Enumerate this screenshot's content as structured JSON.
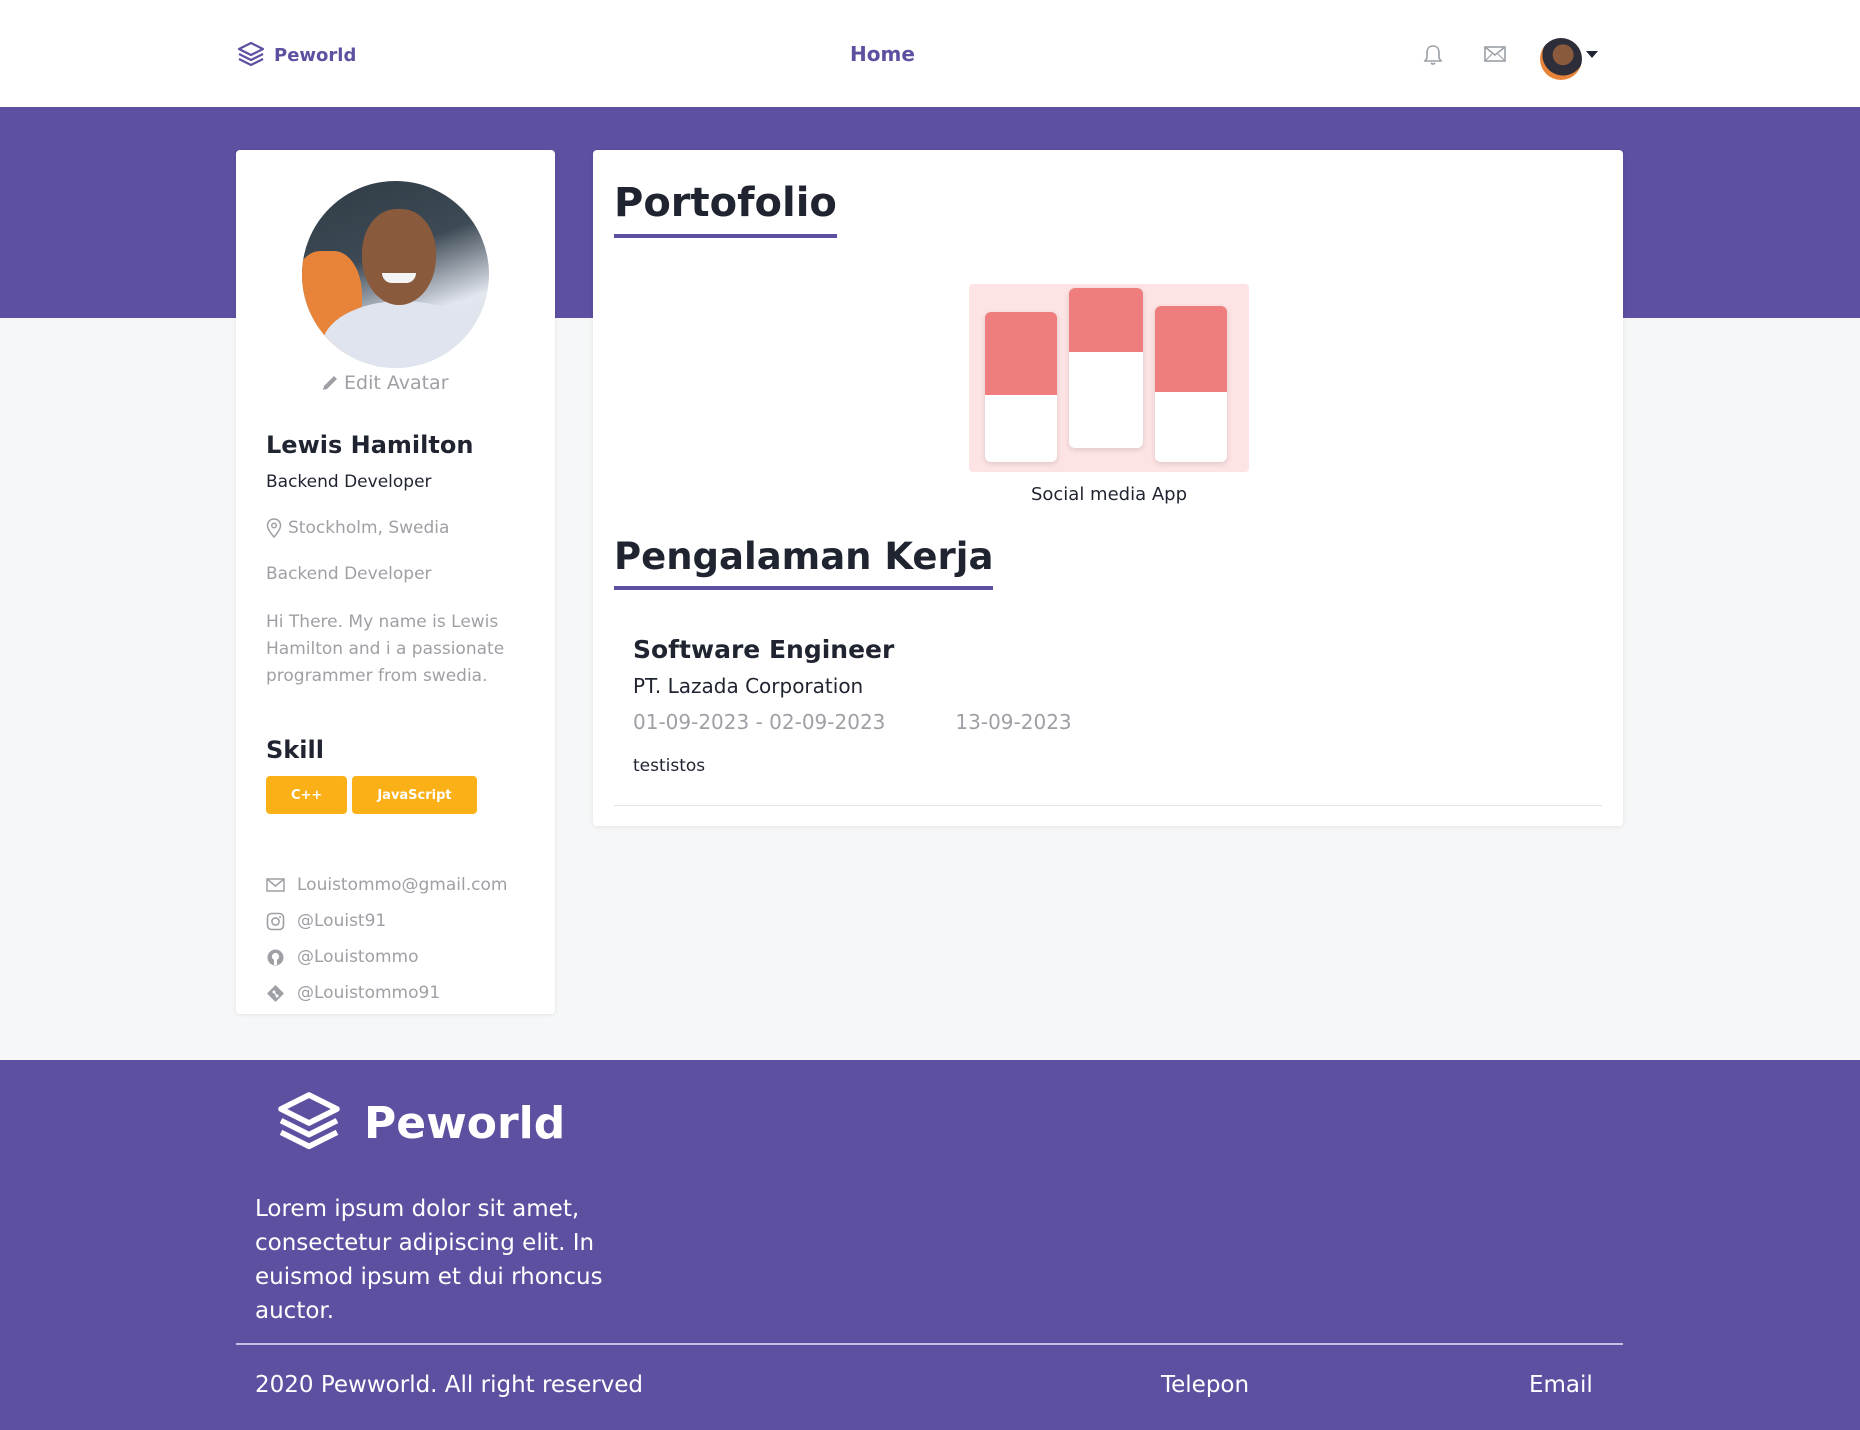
{
  "nav": {
    "brand": "Peworld",
    "home": "Home",
    "icons": [
      "layers-icon",
      "bell-icon",
      "mail-icon",
      "avatar",
      "chevron-down-icon"
    ]
  },
  "profile": {
    "edit_avatar": "Edit Avatar",
    "name": "Lewis Hamilton",
    "job": "Backend Developer",
    "location": "Stockholm, Swedia",
    "job_detail": "Backend Developer",
    "bio": "Hi There. My name is Lewis Hamilton and i a passionate programmer from swedia.",
    "skill_title": "Skill",
    "skills": [
      "C++",
      "JavaScript"
    ],
    "contacts": {
      "email": "Louistommo@gmail.com",
      "instagram": "@Louist91",
      "github": "@Louistommo",
      "gitlab": "@Louistommo91"
    }
  },
  "portfolio": {
    "title": "Portofolio",
    "items": [
      {
        "caption": "Social media App"
      }
    ]
  },
  "experience": {
    "title": "Pengalaman Kerja",
    "items": [
      {
        "role": "Software Engineer",
        "company": "PT. Lazada Corporation",
        "period": "01-09-2023 - 02-09-2023",
        "date": "13-09-2023",
        "description": "testistos"
      }
    ]
  },
  "footer": {
    "brand": "Peworld",
    "text": "Lorem ipsum dolor sit amet, consectetur adipiscing elit. In euismod ipsum et dui rhoncus auctor.",
    "copyright": "2020 Pewworld. All right reserved",
    "phone": "Telepon",
    "email": "Email"
  },
  "colors": {
    "primary": "#5e50a1",
    "skill": "#fbb017",
    "muted": "#9ea0a5"
  }
}
